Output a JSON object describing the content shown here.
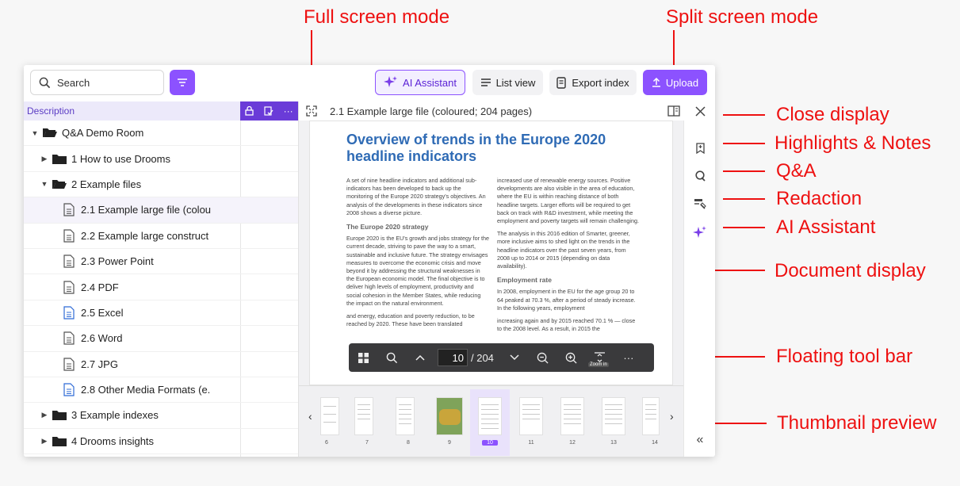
{
  "annotations": {
    "full_screen": "Full screen mode",
    "split_screen": "Split screen mode",
    "close_display": "Close display",
    "highlights_notes": "Highlights & Notes",
    "qa": "Q&A",
    "redaction": "Redaction",
    "ai_assistant": "AI Assistant",
    "document_display": "Document display",
    "floating_toolbar": "Floating tool bar",
    "thumbnail_preview": "Thumbnail preview"
  },
  "toolbar": {
    "search_placeholder": "Search",
    "ai_label": "AI Assistant",
    "list_label": "List view",
    "export_label": "Export index",
    "upload_label": "Upload"
  },
  "tree": {
    "header": "Description",
    "rows": [
      {
        "label": "Q&A Demo Room"
      },
      {
        "label": "1 How to use Drooms"
      },
      {
        "label": "2 Example files"
      },
      {
        "label": "2.1 Example large file (colou"
      },
      {
        "label": "2.2 Example large construct"
      },
      {
        "label": "2.3 Power Point"
      },
      {
        "label": "2.4 PDF"
      },
      {
        "label": "2.5 Excel"
      },
      {
        "label": "2.6 Word"
      },
      {
        "label": "2.7 JPG"
      },
      {
        "label": "2.8 Other Media Formats (e."
      },
      {
        "label": "3 Example indexes"
      },
      {
        "label": "4 Drooms insights"
      }
    ]
  },
  "viewer": {
    "title": "2.1 Example large file (coloured; 204 pages)",
    "doc": {
      "heading": "Overview of trends in the Europe 2020 headline indicators",
      "left_p1": "A set of nine headline indicators and additional sub-indicators has been developed to back up the monitoring of the Europe 2020 strategy's objectives. An analysis of the developments in these indicators since 2008 shows a diverse picture.",
      "left_h": "The Europe 2020 strategy",
      "left_p2": "Europe 2020 is the EU's growth and jobs strategy for the current decade, striving to pave the way to a smart, sustainable and inclusive future. The strategy envisages measures to overcome the economic crisis and move beyond it by addressing the structural weaknesses in the European economic model. The final objective is to deliver high levels of employment, productivity and social cohesion in the Member States, while reducing the impact on the natural environment.",
      "left_p3": "and energy, education and poverty reduction, to be reached by 2020. These have been translated",
      "right_p1": "increased use of renewable energy sources. Positive developments are also visible in the area of education, where the EU is within reaching distance of both headline targets. Larger efforts will be required to get back on track with R&D investment, while meeting the employment and poverty targets will remain challenging.",
      "right_p2": "The analysis in this 2016 edition of Smarter, greener, more inclusive aims to shed light on the trends in the headline indicators over the past seven years, from 2008 up to 2014 or 2015 (depending on data availability).",
      "right_h": "Employment rate",
      "right_p3": "In 2008, employment in the EU for the age group 20 to 64 peaked at 70.3 %, after a period of steady increase. In the following years, employment",
      "right_p4": "increasing again and by 2015 reached 70.1 % — close to the 2008 level. As a result, in 2015 the"
    },
    "floatbar": {
      "page": "10",
      "total": "/ 204",
      "zoom_tip": "Zoom in"
    },
    "thumbnails": [
      "6",
      "7",
      "8",
      "9",
      "10",
      "11",
      "12",
      "13",
      "14"
    ],
    "selected_thumbnail": "10"
  },
  "colors": {
    "accent": "#8c52ff",
    "annotation": "#ee1111",
    "doc_heading": "#2f6bb5"
  }
}
